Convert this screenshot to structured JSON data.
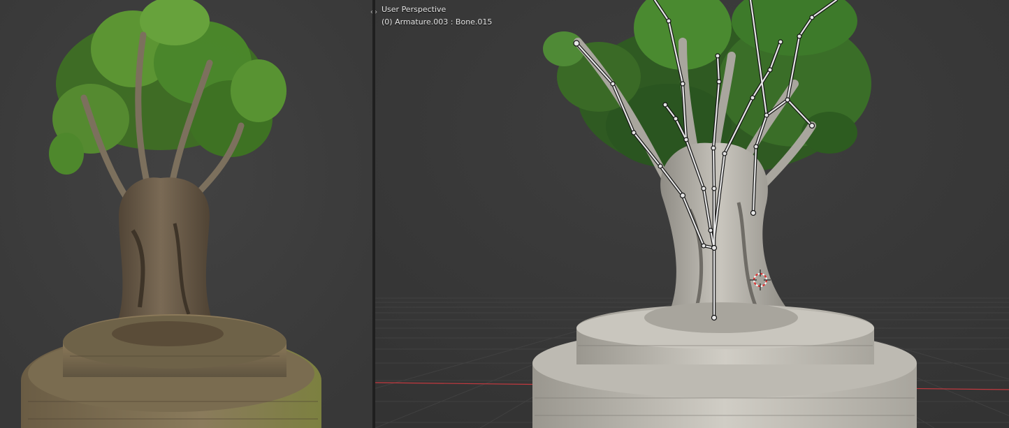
{
  "viewport_right": {
    "view_name": "User Perspective",
    "active_object": "(0) Armature.003 : Bone.015"
  },
  "split_handle": {
    "glyph": "‹›"
  },
  "colors": {
    "viewport_bg": "#3a3a3a",
    "grid_line": "#444444",
    "x_axis": "#c3393f",
    "foliage": "#4a8a2a",
    "bark_left": "#6b5a46",
    "bark_right": "#b8b5ad",
    "bone": "#e6e6e6",
    "bone_outline": "#111111"
  }
}
